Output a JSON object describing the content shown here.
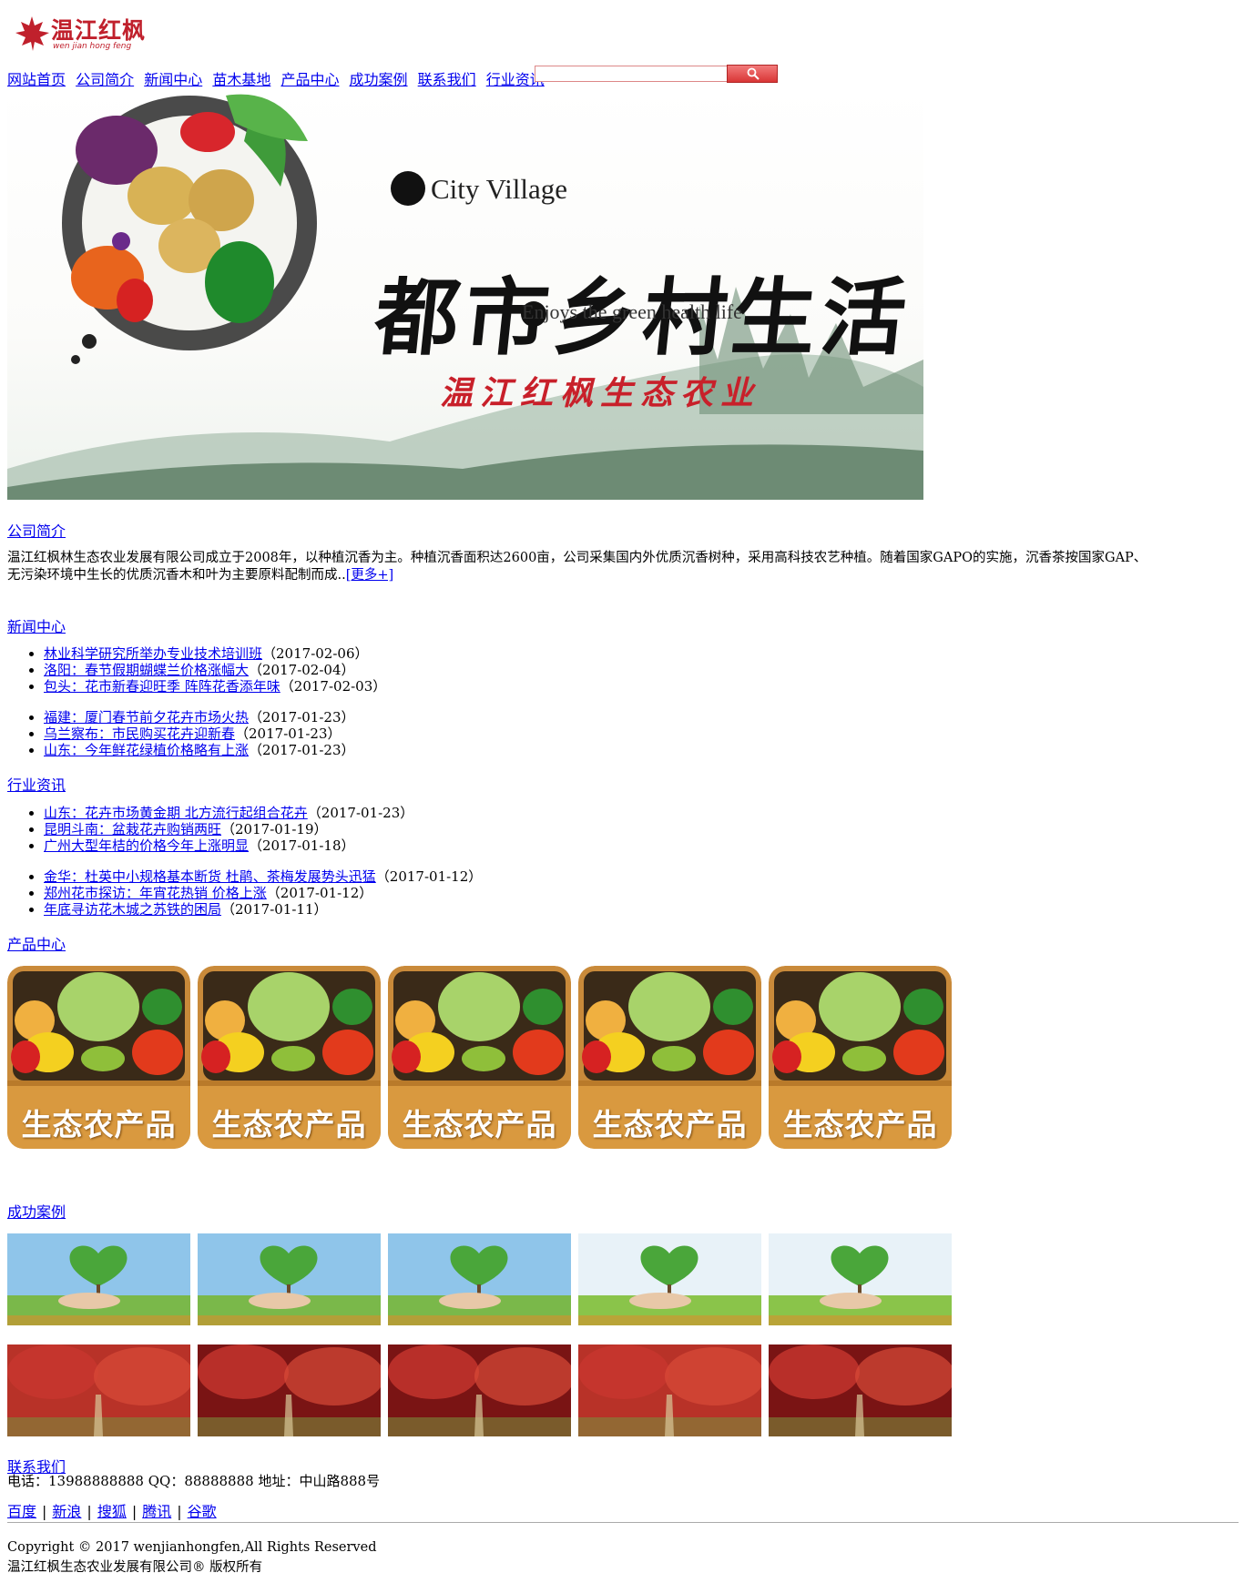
{
  "logo": {
    "text": "温江红枫",
    "subtext": "wen jian hong feng"
  },
  "nav": {
    "items": [
      "网站首页",
      "公司简介",
      "新闻中心",
      "苗木基地",
      "产品中心",
      "成功案例",
      "联系我们",
      "行业资讯"
    ]
  },
  "search": {
    "value": "",
    "button_icon": "search-icon"
  },
  "banner": {
    "en_title": "City Village",
    "cn_title": "都市乡村生活",
    "en_sub": "Enjoys the green health life",
    "cn_company": "温江红枫生态农业"
  },
  "intro": {
    "title": "公司简介",
    "text_line1": "温江红枫林生态农业发展有限公司成立于2008年，以种植沉香为主。种植沉香面积达2600亩，公司采集国内外优质沉香树种，采用高科技农艺种植。随着国家GAPO的实施，沉香茶按国家GAP、",
    "text_line2": "无污染环境中生长的优质沉香木和叶为主要原料配制而成..",
    "more": "[更多+]"
  },
  "news": {
    "title": "新闻中心",
    "group1": [
      {
        "title": "林业科学研究所举办专业技术培训班",
        "date": "（2017-02-06）"
      },
      {
        "title": "洛阳：春节假期蝴蝶兰价格涨幅大",
        "date": "（2017-02-04）"
      },
      {
        "title": "包头：花市新春迎旺季 阵阵花香添年味",
        "date": "（2017-02-03）"
      }
    ],
    "group2": [
      {
        "title": "福建：厦门春节前夕花卉市场火热",
        "date": "（2017-01-23）"
      },
      {
        "title": "乌兰察布：市民购买花卉迎新春",
        "date": "（2017-01-23）"
      },
      {
        "title": "山东：今年鲜花绿植价格略有上涨",
        "date": "（2017-01-23）"
      }
    ]
  },
  "industry": {
    "title": "行业资讯",
    "group1": [
      {
        "title": "山东：花卉市场黄金期 北方流行起组合花卉",
        "date": "（2017-01-23）"
      },
      {
        "title": "昆明斗南：盆栽花卉购销两旺",
        "date": "（2017-01-19）"
      },
      {
        "title": "广州大型年桔的价格今年上涨明显",
        "date": "（2017-01-18）"
      }
    ],
    "group2": [
      {
        "title": "金华：杜英中小规格基本断货 杜鹃、茶梅发展势头迅猛",
        "date": "（2017-01-12）"
      },
      {
        "title": "郑州花市探访：年宵花热销 价格上涨",
        "date": "（2017-01-12）"
      },
      {
        "title": "年底寻访花木城之苏铁的困局",
        "date": "（2017-01-11）"
      }
    ]
  },
  "products": {
    "title": "产品中心",
    "items": [
      "生态农产品",
      "生态农产品",
      "生态农产品",
      "生态农产品",
      "生态农产品"
    ]
  },
  "cases": {
    "title": "成功案例"
  },
  "contact": {
    "title": "联系我们",
    "info": "电话：13988888888 QQ：88888888 地址：中山路888号"
  },
  "footer": {
    "links": [
      "百度",
      "新浪",
      "搜狐",
      "腾讯",
      "谷歌"
    ],
    "separator": "|",
    "copyright": "Copyright © 2017 wenjianhongfen,All Rights Reserved",
    "company": "温江红枫生态农业发展有限公司® 版权所有"
  },
  "colors": {
    "link": "#0000ee",
    "brand_red": "#c0202c",
    "search_button": "#e04848"
  }
}
